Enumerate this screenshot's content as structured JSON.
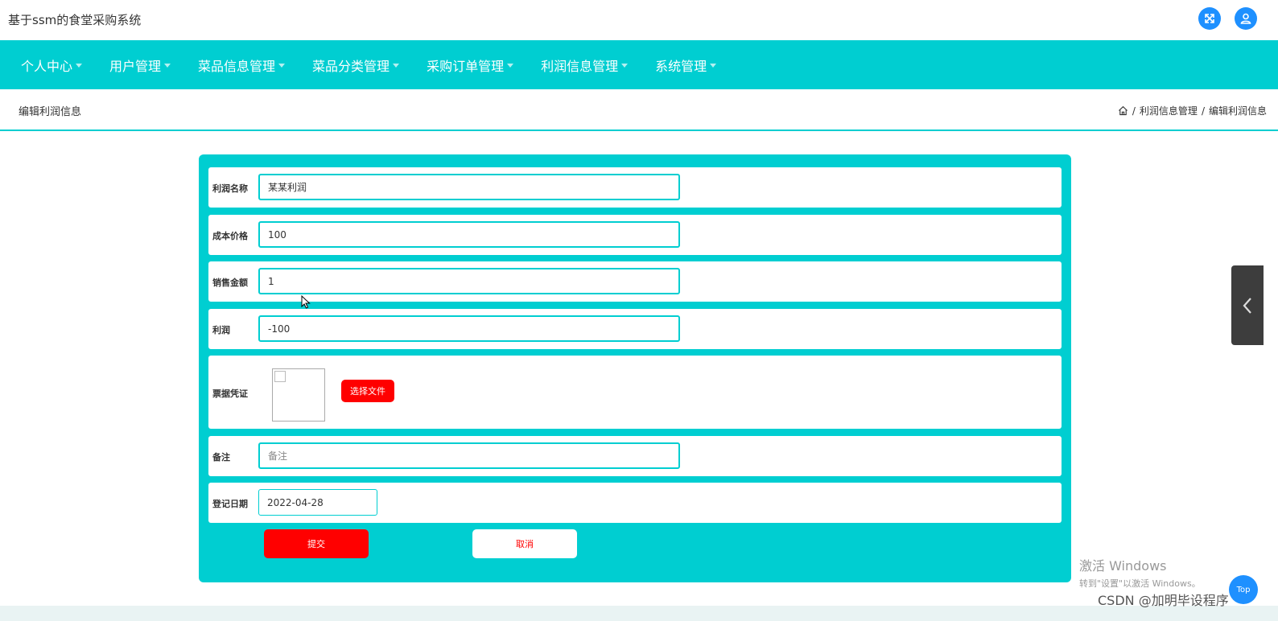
{
  "app": {
    "title": "基于ssm的食堂采购系统"
  },
  "nav": {
    "items": [
      {
        "label": "个人中心"
      },
      {
        "label": "用户管理"
      },
      {
        "label": "菜品信息管理"
      },
      {
        "label": "菜品分类管理"
      },
      {
        "label": "采购订单管理"
      },
      {
        "label": "利润信息管理"
      },
      {
        "label": "系统管理"
      }
    ]
  },
  "page": {
    "title": "编辑利润信息",
    "breadcrumb": [
      "利润信息管理",
      "编辑利润信息"
    ]
  },
  "form": {
    "profit_name": {
      "label": "利润名称",
      "value": "某某利润"
    },
    "cost_price": {
      "label": "成本价格",
      "value": "100"
    },
    "sales_amount": {
      "label": "销售金额",
      "value": "1"
    },
    "profit": {
      "label": "利润",
      "value": "-100"
    },
    "receipt": {
      "label": "票据凭证",
      "button": "选择文件"
    },
    "remark": {
      "label": "备注",
      "placeholder": "备注"
    },
    "date": {
      "label": "登记日期",
      "value": "2022-04-28"
    },
    "submit": "提交",
    "cancel": "取消"
  },
  "overlay": {
    "windows_line1": "激活 Windows",
    "windows_line2": "转到\"设置\"以激活 Windows。",
    "watermark": "CSDN @加明毕设程序",
    "top_button": "Top"
  },
  "colors": {
    "accent": "#00CED1",
    "danger": "#FF0000",
    "icon_blue": "#1E90FF"
  }
}
